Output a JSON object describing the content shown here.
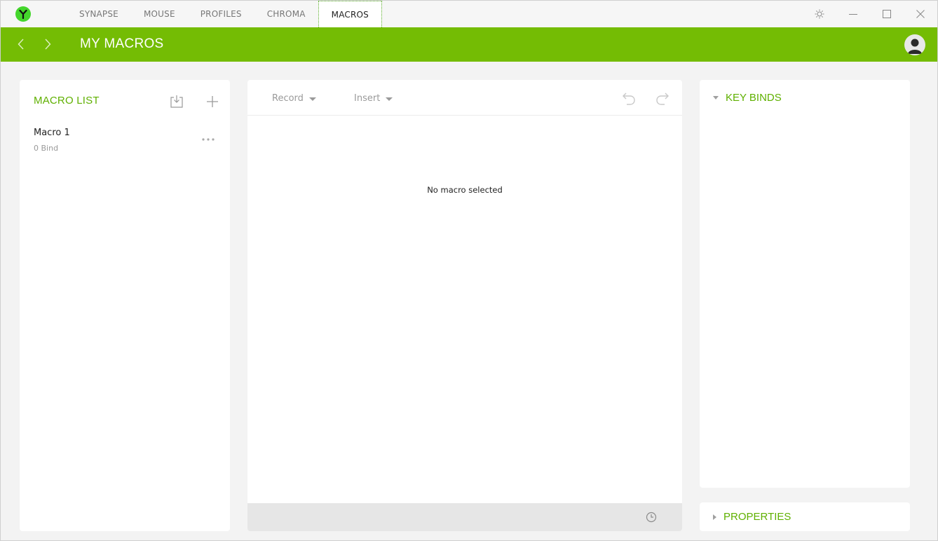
{
  "titlebar": {
    "tabs": [
      {
        "label": "SYNAPSE",
        "active": false
      },
      {
        "label": "MOUSE",
        "active": false
      },
      {
        "label": "PROFILES",
        "active": false
      },
      {
        "label": "CHROMA",
        "active": false
      },
      {
        "label": "MACROS",
        "active": true
      }
    ],
    "controls": [
      "settings-icon",
      "minimize-icon",
      "maximize-icon",
      "close-icon"
    ]
  },
  "header": {
    "title": "MY MACROS"
  },
  "macro_list": {
    "title": "MACRO LIST",
    "items": [
      {
        "name": "Macro 1",
        "binds": "0 Bind"
      }
    ]
  },
  "editor": {
    "record_label": "Record",
    "insert_label": "Insert",
    "empty_message": "No macro selected"
  },
  "keybinds": {
    "title": "KEY BINDS"
  },
  "properties": {
    "title": "PROPERTIES"
  },
  "colors": {
    "accent_green": "#74bc04",
    "title_green": "#5fb000",
    "brand_logo": "#44d62c"
  }
}
